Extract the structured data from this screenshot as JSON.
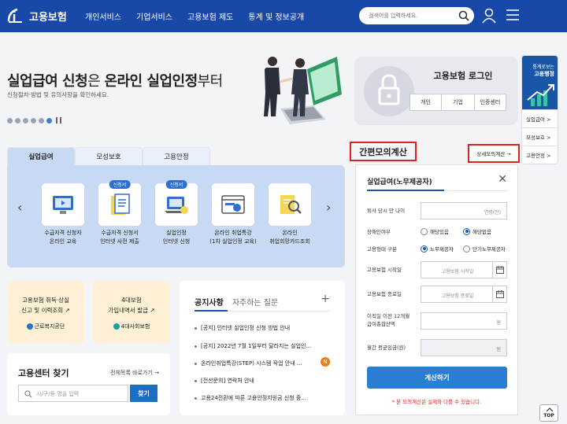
{
  "header": {
    "logo_text": "고용보험",
    "nav": [
      "개인서비스",
      "기업서비스",
      "고용보험 제도",
      "통계 및 정보공개"
    ],
    "search_placeholder": "검색어를 입력하세요."
  },
  "banner": {
    "title_a": "실업급여 신청",
    "title_b": "은 ",
    "title_c": "온라인 실업인정",
    "title_d": "부터",
    "subtitle": "신청절차·방법 및 유의사항을 확인하세요."
  },
  "login": {
    "title": "고용보험 로그인",
    "buttons": [
      "개인",
      "기업",
      "인증센터"
    ]
  },
  "quick_menu": {
    "top_line1": "통계로보는",
    "top_line2": "고용행정",
    "items": [
      "실업급여 >",
      "모성보호 >",
      "고용안정 >"
    ]
  },
  "service_tabs": [
    "실업급여",
    "모성보호",
    "고용안정"
  ],
  "services": [
    {
      "badge": "",
      "line1": "수급자격 신청자",
      "line2": "온라인 교육"
    },
    {
      "badge": "신청서",
      "line1": "수급자격 신청서",
      "line2": "인터넷 사전 제출"
    },
    {
      "badge": "신청서",
      "line1": "실업인정",
      "line2": "인터넷 신청"
    },
    {
      "badge": "",
      "line1": "온라인 취업특강",
      "line2": "(1차 실업인정 교육)"
    },
    {
      "badge": "",
      "line1": "온라인",
      "line2": "취업희망카드조회"
    }
  ],
  "link_boxes": [
    {
      "line1": "고용보험 취득·상실",
      "line2": "신고 및 이력조회",
      "org": "근로복지공단"
    },
    {
      "line1": "4대보험",
      "line2": "가입내역서 발급",
      "org": "4대사회보험"
    }
  ],
  "center_find": {
    "title": "고용센터 찾기",
    "all_link": "전체목록 바로가기 →",
    "placeholder": "시/구/동 명을 입력",
    "button": "찾기"
  },
  "notice": {
    "tabs": [
      "공지사항",
      "자주하는 질문"
    ],
    "plus": "+",
    "items": [
      "[공지] 인터넷 실업인정 신청 방법 안내",
      "[공지] 2022년 7월 1일부터 달라지는 실업인...",
      "온라인취업특강(STEP) 시스템 작업 안내 ...",
      "[전산문의] 연락처 안내",
      "고용24전환에 따른 고용안정지원금 신청 중..."
    ],
    "new_badge": "N"
  },
  "calculator": {
    "section_title": "간편모의계산",
    "detail_link": "상세모의계산 →",
    "card_title": "실업급여(노무제공자)",
    "close": "✕",
    "age_label": "퇴사 당시 만 나이",
    "age_unit": "연령(만)",
    "disabled_label": "장애인여부",
    "disabled_options": [
      "해당있음",
      "해당없음"
    ],
    "type_label": "고용형태 구분",
    "type_options": [
      "노무제공자",
      "단기노무제공자"
    ],
    "start_label": "고용보험 시작일",
    "start_placeholder": "고용보험 시작일",
    "end_label": "고용보험 종료일",
    "end_placeholder": "고용보험 종료일",
    "income_label_1": "이직일 이전 12개월",
    "income_label_2": "급여총합산액",
    "income_unit": "원",
    "avg_label": "월간 평균임금(원)",
    "avg_unit": "원",
    "button": "계산하기",
    "note": "* 본 모의계산은 실제와 다를 수 있습니다."
  },
  "top_button": "TOP",
  "colors": {
    "header": "#1848a8",
    "accent": "#2b7fd3",
    "highlight_border": "#dd2222"
  }
}
